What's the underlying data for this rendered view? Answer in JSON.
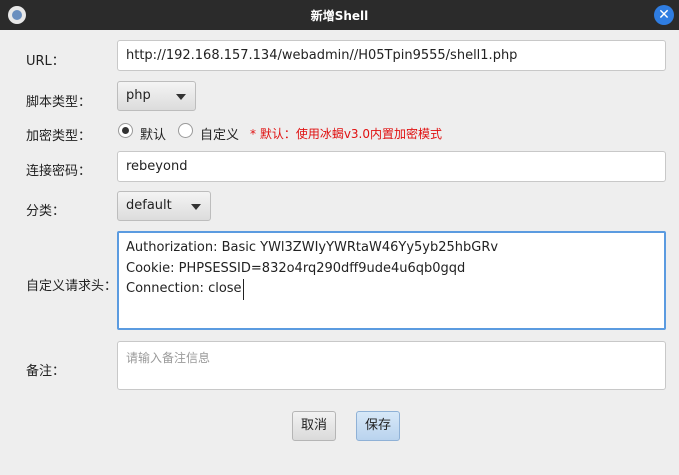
{
  "window": {
    "title": "新增Shell",
    "close_glyph": "✕"
  },
  "form": {
    "url": {
      "label": "URL：",
      "value": "http://192.168.157.134/webadmin//H05Tpin9555/shell1.php"
    },
    "script_type": {
      "label": "脚本类型：",
      "selected": "php"
    },
    "encryption": {
      "label": "加密类型：",
      "options": [
        {
          "label": "默认",
          "checked": true
        },
        {
          "label": "自定义",
          "checked": false
        }
      ],
      "note": "* 默认：使用冰蝎v3.0内置加密模式"
    },
    "password": {
      "label": "连接密码：",
      "value": "rebeyond"
    },
    "category": {
      "label": "分类：",
      "selected": "default"
    },
    "headers": {
      "label": "自定义请求头：",
      "lines": [
        "Authorization: Basic YWl3ZWIyYWRtaW46Yy5yb25hbGRv",
        "Cookie: PHPSESSID=832o4rq290dff9ude4u6qb0gqd",
        "Connection: close"
      ]
    },
    "remark": {
      "label": "备注：",
      "placeholder": "请输入备注信息"
    }
  },
  "buttons": {
    "cancel": "取消",
    "save": "保存"
  },
  "colors": {
    "titlebar": "#2b2b2b",
    "note": "#e01010",
    "focus_border": "#5b9be0"
  }
}
